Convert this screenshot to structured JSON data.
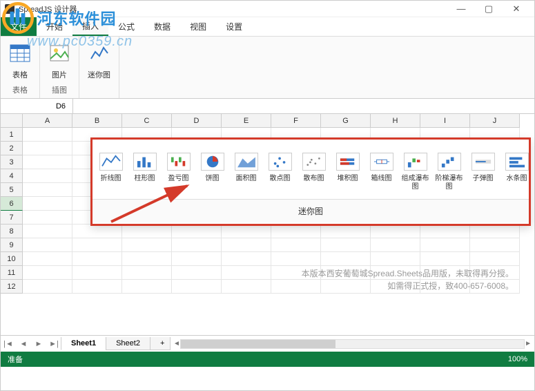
{
  "window": {
    "title": "SpreadJS 设计器",
    "min": "—",
    "max": "▢",
    "close": "✕"
  },
  "watermark": {
    "site": "河东软件园",
    "url": "www.pc0359.cn"
  },
  "menu": {
    "file": "文件",
    "tabs": [
      "开始",
      "插入",
      "公式",
      "数据",
      "视图",
      "设置"
    ],
    "active_index": 1
  },
  "ribbon": {
    "groups": [
      {
        "btn": "表格",
        "name": "表格",
        "icon": "table-icon"
      },
      {
        "btn": "图片",
        "name": "插图",
        "icon": "picture-icon"
      },
      {
        "btn": "迷你图",
        "name": "",
        "icon": "sparkline-icon"
      }
    ]
  },
  "namebox": "D6",
  "columns": [
    "A",
    "B",
    "C",
    "D",
    "E",
    "F",
    "G",
    "H",
    "I",
    "J"
  ],
  "rows": [
    "1",
    "2",
    "3",
    "4",
    "5",
    "6",
    "7",
    "8",
    "9",
    "10",
    "11",
    "12"
  ],
  "active_row": "6",
  "dropdown": {
    "footer": "迷你图",
    "items": [
      {
        "label": "折线图",
        "icon": "line-chart-icon"
      },
      {
        "label": "柱形图",
        "icon": "bar-chart-icon"
      },
      {
        "label": "盈亏图",
        "icon": "winloss-chart-icon"
      },
      {
        "label": "饼图",
        "icon": "pie-chart-icon"
      },
      {
        "label": "面积图",
        "icon": "area-chart-icon"
      },
      {
        "label": "散点图",
        "icon": "scatter-chart-icon"
      },
      {
        "label": "散布图",
        "icon": "spread-chart-icon"
      },
      {
        "label": "堆积图",
        "icon": "stacked-chart-icon"
      },
      {
        "label": "箱线图",
        "icon": "box-chart-icon"
      },
      {
        "label": "组成瀑布图",
        "icon": "waterfall-chart-icon"
      },
      {
        "label": "阶梯瀑布图",
        "icon": "step-waterfall-icon"
      },
      {
        "label": "子弹图",
        "icon": "bullet-chart-icon"
      },
      {
        "label": "水条图",
        "icon": "hbar-chart-icon"
      }
    ]
  },
  "notice": {
    "line1": "本版本西安葡萄城Spread.Sheets品用版，未取得再分授。",
    "line2": "如需得正式授，致400-657-6008。"
  },
  "sheets": {
    "list": [
      "Sheet1",
      "Sheet2"
    ],
    "active": 0,
    "add": "+"
  },
  "scroll": {
    "left": "◄",
    "right": "►",
    "first": "|◄",
    "last": "►|"
  },
  "status": {
    "text": "准备",
    "zoom": "100%"
  }
}
